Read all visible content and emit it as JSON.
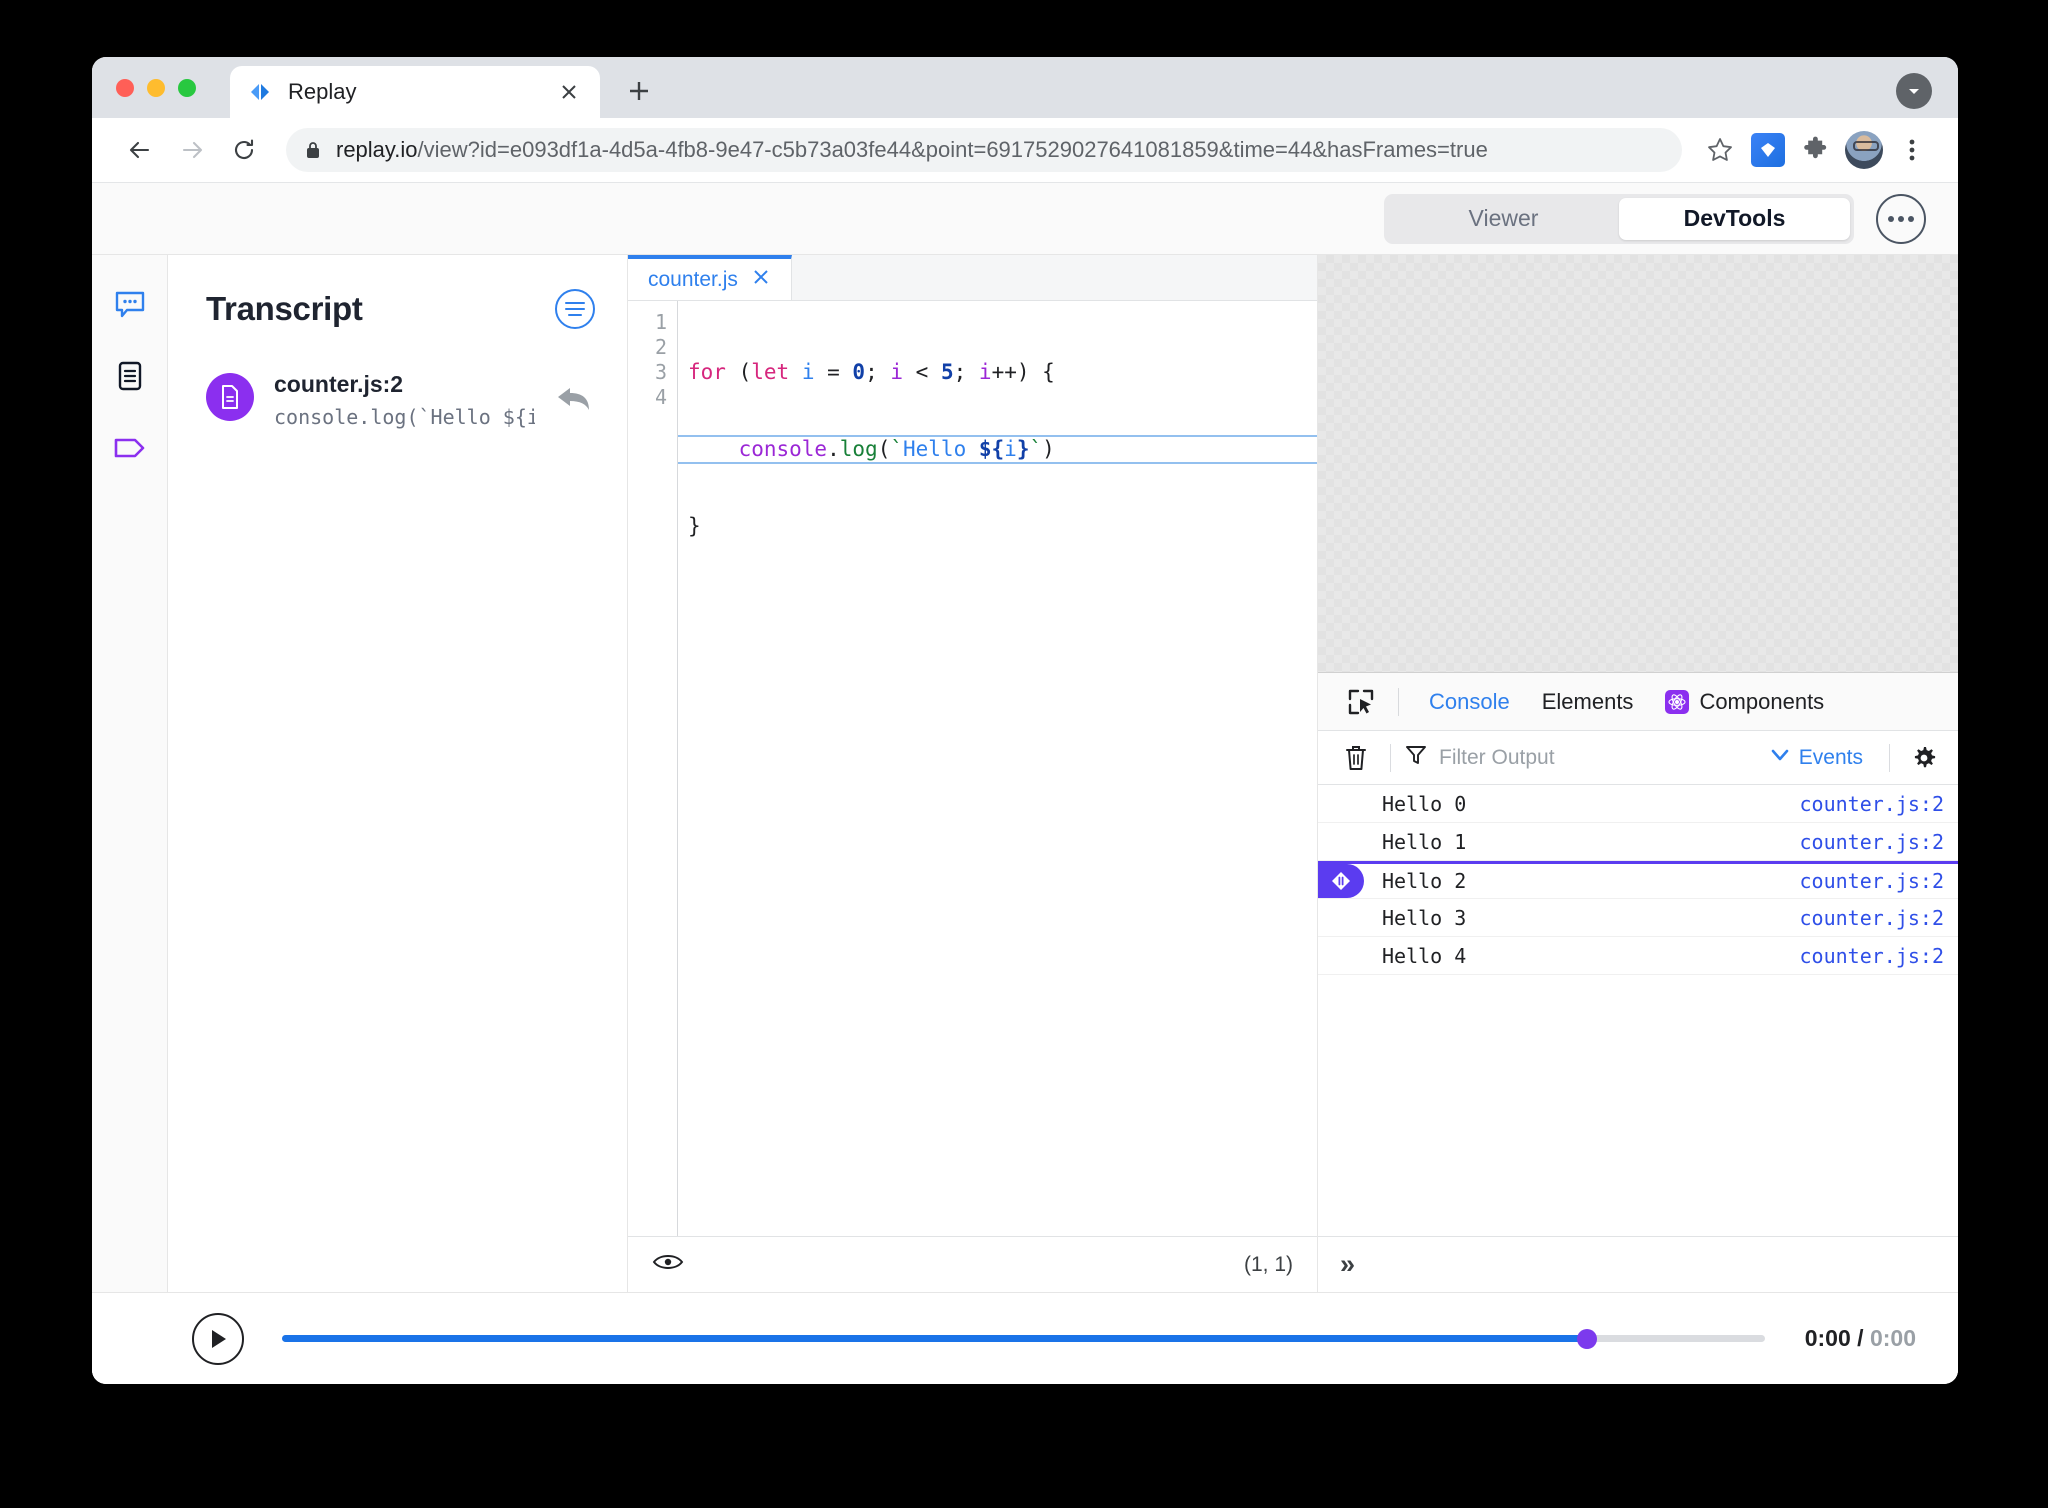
{
  "browser": {
    "tab": {
      "title": "Replay",
      "favicon": "replay-logo-icon",
      "close": "×"
    },
    "new_tab_label": "+",
    "url": {
      "host": "replay.io",
      "path": "/view?id=e093df1a-4d5a-4fb8-9e47-c5b73a03fe44&point=6917529027641081859&time=44&hasFrames=true",
      "full": "replay.io/view?id=e093df1a-4d5a-4fb8-9e47-c5b73a03fe44&point=6917529027641081859&time=44&hasFrames=true"
    },
    "toolbar_icons": [
      "back-icon",
      "forward-icon",
      "reload-icon",
      "lock-icon",
      "bookmark-star-icon",
      "replay-extension-icon",
      "puzzle-extension-icon",
      "profile-avatar",
      "browser-menu-icon"
    ]
  },
  "app_header": {
    "modes": [
      {
        "label": "Viewer",
        "active": false
      },
      {
        "label": "DevTools",
        "active": true
      }
    ],
    "more_button": "more-options-icon"
  },
  "rail": {
    "items": [
      {
        "name": "comments",
        "icon": "comment-bubble-icon",
        "color": "#2f80ed"
      },
      {
        "name": "events",
        "icon": "document-lines-icon",
        "color": "#111827"
      },
      {
        "name": "tags",
        "icon": "tag-icon",
        "color": "#8b2fef"
      }
    ]
  },
  "transcript": {
    "title": "Transcript",
    "menu_icon": "list-menu-icon",
    "items": [
      {
        "avatar_icon": "source-file-icon",
        "location": "counter.js:2",
        "snippet": "console.log(`Hello ${i…",
        "reply_icon": "reply-arrow-icon"
      }
    ]
  },
  "editor": {
    "tabs": [
      {
        "label": "counter.js",
        "active": true,
        "close": "✕"
      }
    ],
    "gutter": [
      "1",
      "2",
      "3",
      "4"
    ],
    "lines": [
      {
        "num": 1,
        "highlighted": false,
        "text": "for (let i = 0; i < 5; i++) {"
      },
      {
        "num": 2,
        "highlighted": true,
        "text": "    console.log(`Hello ${i}`)"
      },
      {
        "num": 3,
        "highlighted": false,
        "text": "}"
      },
      {
        "num": 4,
        "highlighted": false,
        "text": ""
      }
    ],
    "footer": {
      "eye_icon": "eye-icon",
      "cursor_position": "(1, 1)"
    }
  },
  "devtools": {
    "viewer_placeholder": "empty-checkerboard-viewport",
    "picker_icon": "element-picker-icon",
    "tabs": [
      {
        "label": "Console",
        "active": true,
        "icon": null
      },
      {
        "label": "Elements",
        "active": false,
        "icon": null
      },
      {
        "label": "Components",
        "active": false,
        "icon": "react-components-icon"
      }
    ],
    "console_toolbar": {
      "clear_icon": "trash-icon",
      "filter_icon": "filter-funnel-icon",
      "filter_value": "",
      "filter_placeholder": "Filter Output",
      "events_label": "Events",
      "events_chevron": "chevron-down-icon",
      "settings_icon": "gear-icon"
    },
    "console_messages": [
      {
        "text": "Hello 0",
        "source": "counter.js:2",
        "current": false
      },
      {
        "text": "Hello 1",
        "source": "counter.js:2",
        "current": false
      },
      {
        "text": "Hello 2",
        "source": "counter.js:2",
        "current": true
      },
      {
        "text": "Hello 3",
        "source": "counter.js:2",
        "current": false
      },
      {
        "text": "Hello 4",
        "source": "counter.js:2",
        "current": false
      }
    ],
    "console_footer": {
      "expand_icon": "»"
    }
  },
  "timeline": {
    "play_icon": "play-icon",
    "progress_percent": 88,
    "current_time": "0:00",
    "separator": "/",
    "total_time": "0:00"
  },
  "colors": {
    "accent_blue": "#2f80ed",
    "purple": "#8b2fef",
    "pause_purple": "#5b3cf0",
    "track_blue": "#1a73e8",
    "knob_purple": "#7c3aed"
  }
}
